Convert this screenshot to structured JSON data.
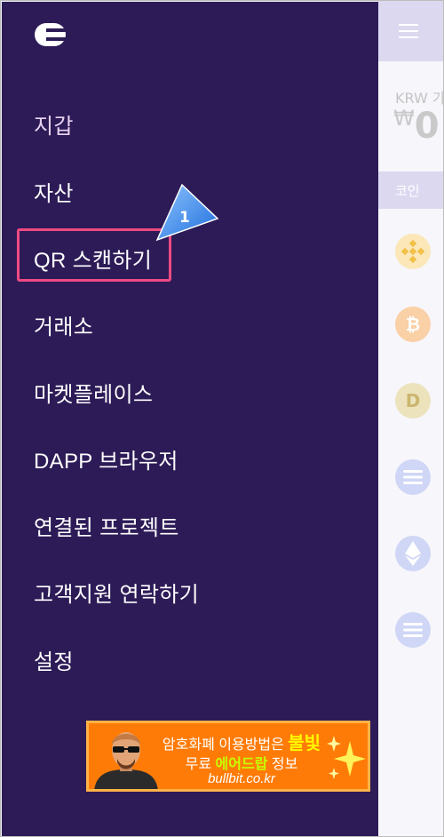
{
  "menu": {
    "items": [
      {
        "label": "지갑"
      },
      {
        "label": "자산"
      },
      {
        "label": "QR 스캔하기"
      },
      {
        "label": "거래소"
      },
      {
        "label": "마켓플레이스"
      },
      {
        "label": "DAPP 브라우저"
      },
      {
        "label": "연결된 프로젝트"
      },
      {
        "label": "고객지원 연락하기"
      },
      {
        "label": "설정"
      }
    ],
    "highlighted_item": "QR 스캔하기"
  },
  "annotation": {
    "step_number": "1"
  },
  "background_app": {
    "balance_label": "KRW 가",
    "balance_currency": "₩",
    "balance_value": "0",
    "coin_header": "코인",
    "coins": [
      {
        "icon": "binance-icon",
        "color": "#f3ba2f"
      },
      {
        "icon": "bitcoin-icon",
        "color": "#f7931a",
        "glyph": "₿"
      },
      {
        "icon": "dogecoin-icon",
        "color": "#c2a633",
        "glyph": "D"
      },
      {
        "icon": "enjin-icon",
        "color": "#6f8be8"
      },
      {
        "icon": "ethereum-icon",
        "color": "#627eea"
      },
      {
        "icon": "enjin-icon",
        "color": "#6f8be8"
      }
    ]
  },
  "ad": {
    "line1_prefix": "암호화폐 이용방법은 ",
    "line1_highlight": "불빛",
    "line2_prefix": "무료 ",
    "line2_highlight": "에어드랍",
    "line2_suffix": " 정보",
    "url": "bullbit.co.kr"
  },
  "colors": {
    "drawer_bg": "#2d1b57",
    "highlight_border": "#ef4a83",
    "pointer": "#3d8ef0",
    "ad_bg": "#ff7b07"
  }
}
